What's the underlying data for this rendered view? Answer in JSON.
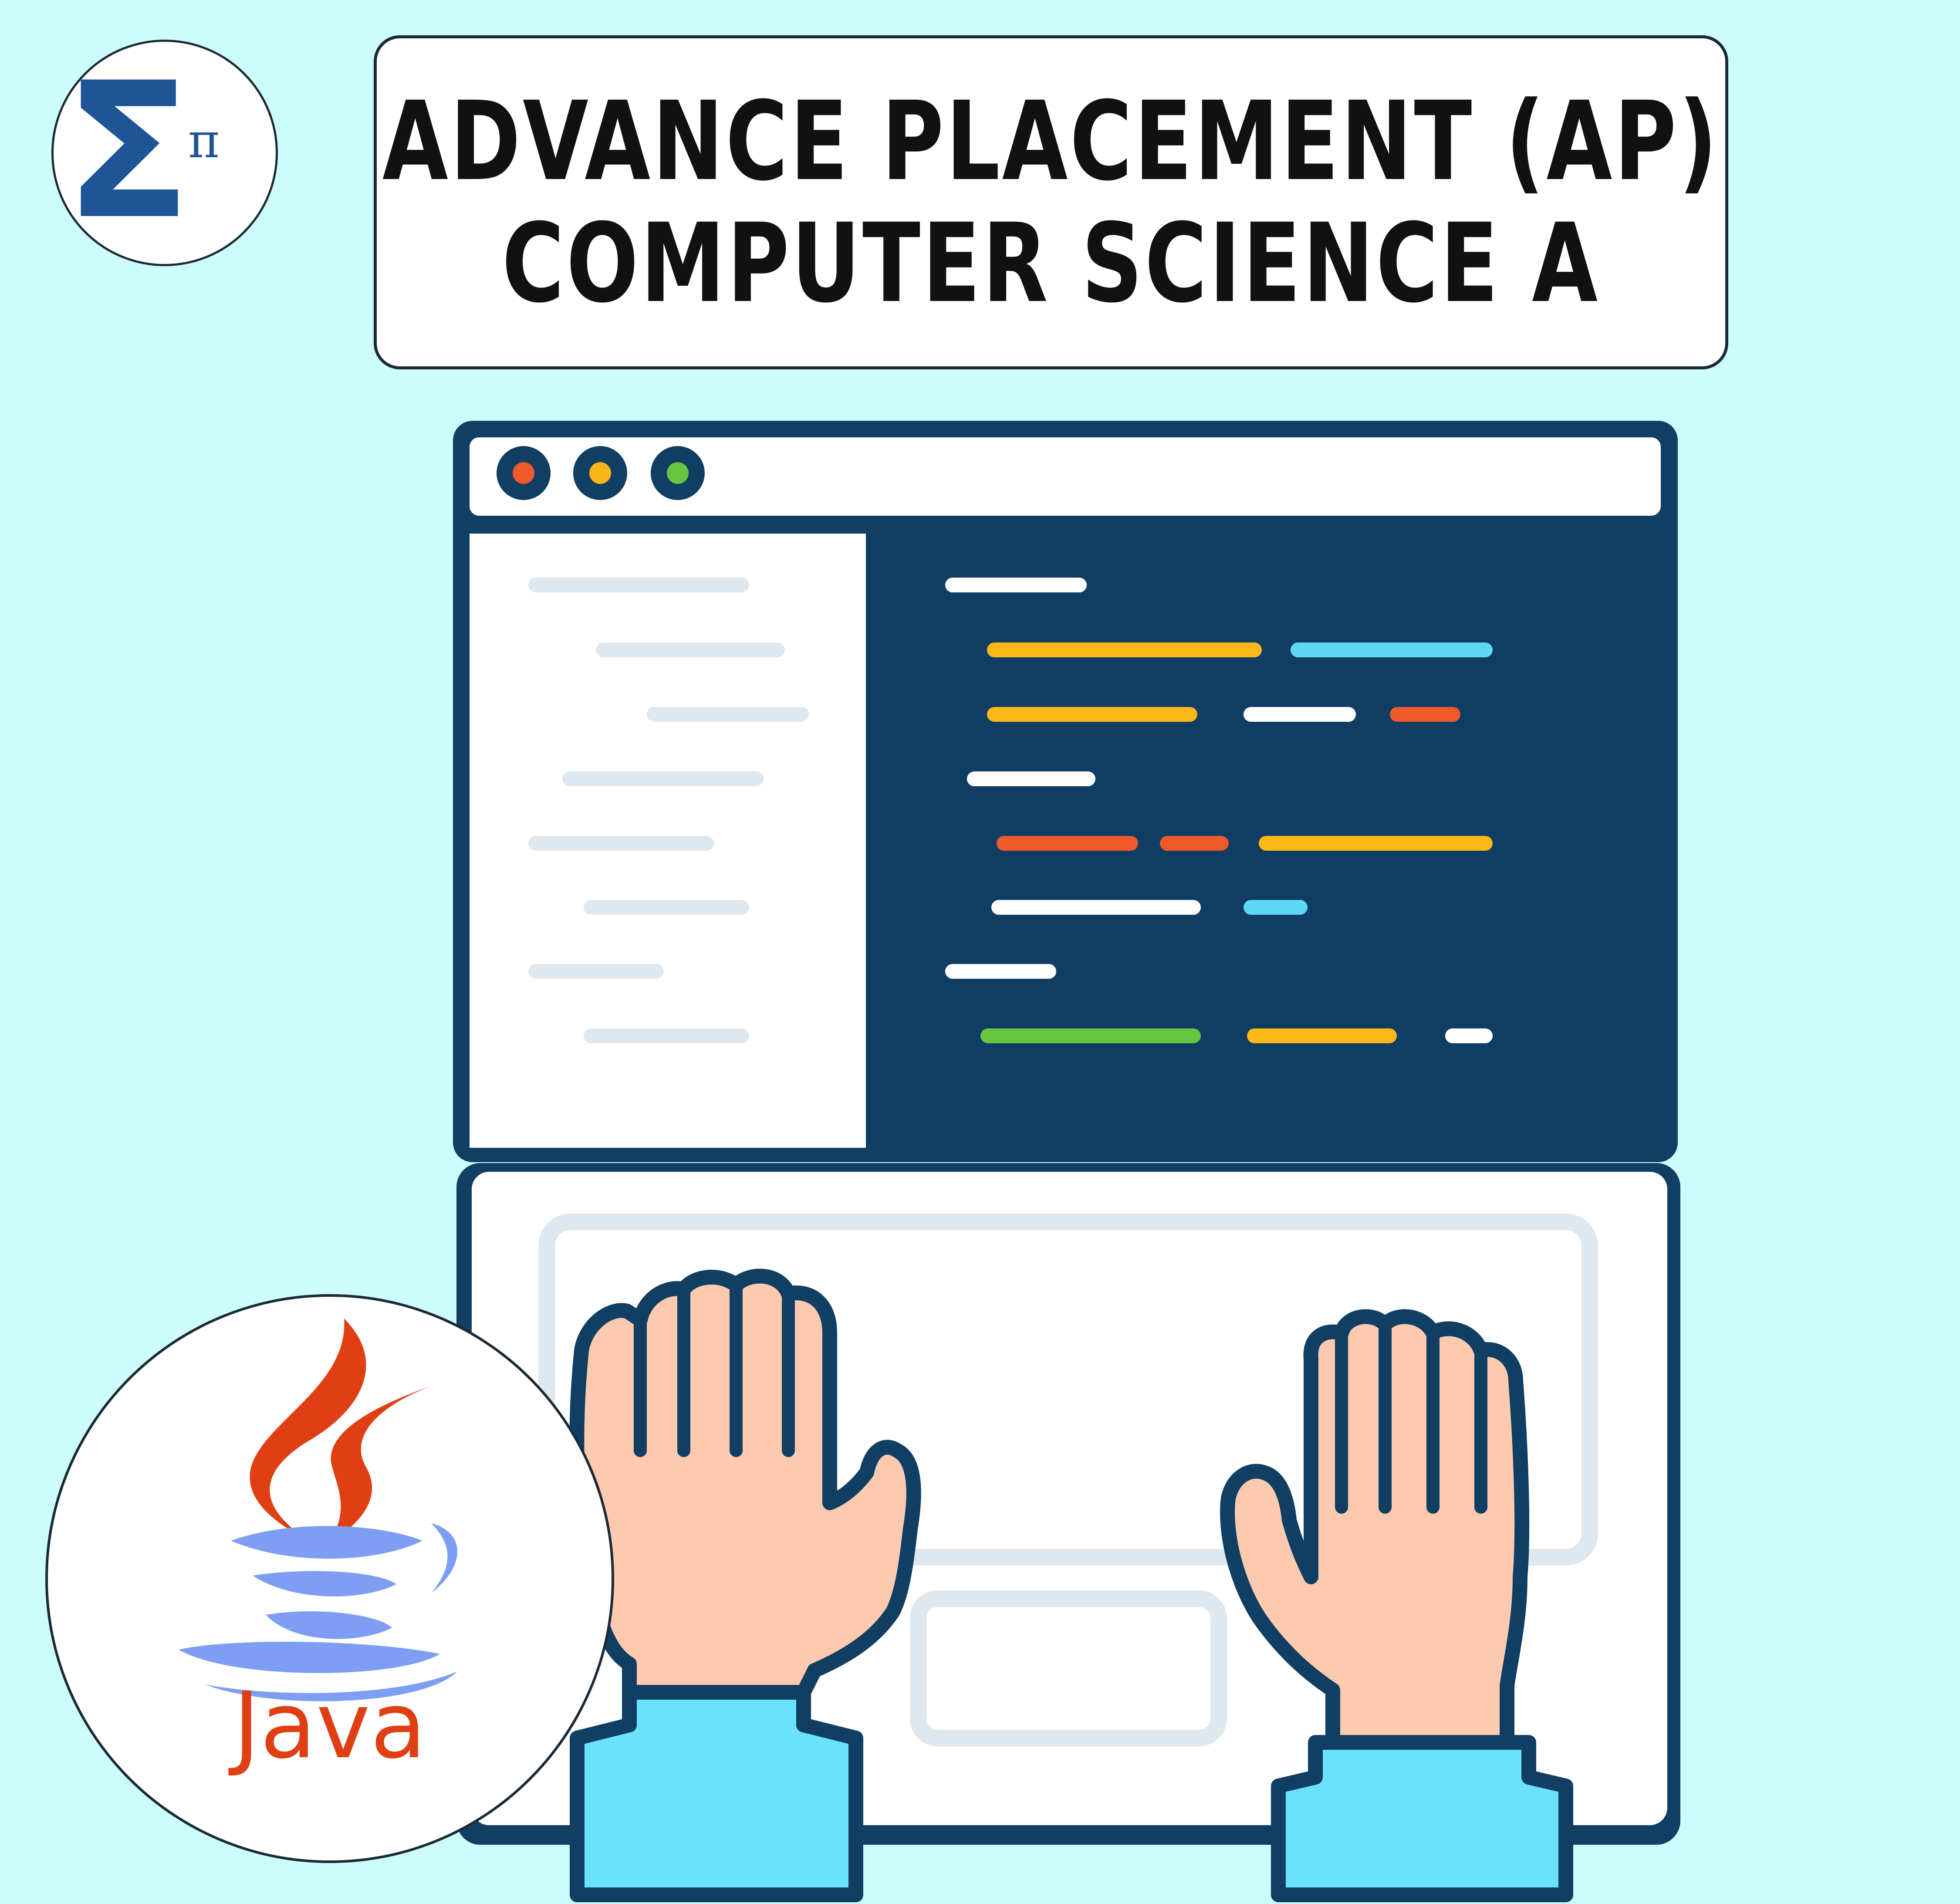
{
  "brand": {
    "logo_glyph": "Σ",
    "logo_superscript": "π",
    "logo_color": "#1f5597"
  },
  "title": {
    "line1": "ADVANCE PLACEMENT (AP)",
    "line2": "COMPUTER SCIENCE A"
  },
  "java_badge": {
    "label": "Java",
    "cup_color": "#7d9ef2",
    "flame_color": "#df3f13"
  },
  "window": {
    "controls": [
      {
        "name": "close",
        "color": "#f05a2a"
      },
      {
        "name": "minimize",
        "color": "#f9b51a"
      },
      {
        "name": "maximize",
        "color": "#66c63f"
      }
    ]
  },
  "colors": {
    "background": "#cdfcfd",
    "navy": "#0f3d64",
    "outline": "#113e63",
    "skin": "#fdcaaf",
    "sleeve": "#6ae2fd",
    "code_yellow": "#fbb817",
    "code_cyan": "#5fd8f6",
    "code_orange": "#f05a2a",
    "code_green": "#66c63f",
    "code_white": "#ffffff",
    "sidebar_line": "#dfe8ef"
  }
}
